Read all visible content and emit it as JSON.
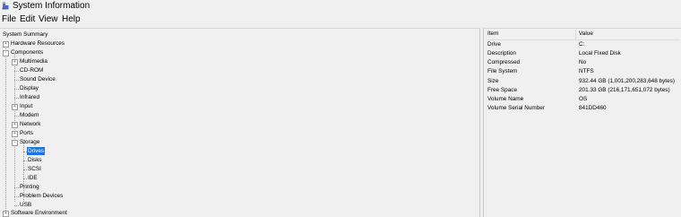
{
  "window": {
    "title": "System Information"
  },
  "menu": [
    "File",
    "Edit",
    "View",
    "Help"
  ],
  "tree": [
    {
      "label": "System Summary",
      "toggle": ""
    },
    {
      "label": "Hardware Resources",
      "toggle": "+"
    },
    {
      "label": "Components",
      "toggle": "-"
    },
    {
      "label": "Multimedia",
      "toggle": "+"
    },
    {
      "label": "CD-ROM",
      "toggle": ""
    },
    {
      "label": "Sound Device",
      "toggle": ""
    },
    {
      "label": "Display",
      "toggle": ""
    },
    {
      "label": "Infrared",
      "toggle": ""
    },
    {
      "label": "Input",
      "toggle": "+"
    },
    {
      "label": "Modem",
      "toggle": ""
    },
    {
      "label": "Network",
      "toggle": "+"
    },
    {
      "label": "Ports",
      "toggle": "+"
    },
    {
      "label": "Storage",
      "toggle": "-"
    },
    {
      "label": "Drives",
      "toggle": "",
      "selected": true
    },
    {
      "label": "Disks",
      "toggle": ""
    },
    {
      "label": "SCSI",
      "toggle": ""
    },
    {
      "label": "IDE",
      "toggle": ""
    },
    {
      "label": "Printing",
      "toggle": ""
    },
    {
      "label": "Problem Devices",
      "toggle": ""
    },
    {
      "label": "USB",
      "toggle": ""
    },
    {
      "label": "Software Environment",
      "toggle": "+"
    }
  ],
  "details": {
    "headers": {
      "item": "Item",
      "value": "Value"
    },
    "rows": [
      {
        "item": "Drive",
        "value": "C:"
      },
      {
        "item": "Description",
        "value": "Local Fixed Disk"
      },
      {
        "item": "Compressed",
        "value": "No"
      },
      {
        "item": "File System",
        "value": "NTFS"
      },
      {
        "item": "Size",
        "value": "932.44 GB (1,001,200,283,648 bytes)"
      },
      {
        "item": "Free Space",
        "value": "201.33 GB (216,171,651,072 bytes)"
      },
      {
        "item": "Volume Name",
        "value": "OS"
      },
      {
        "item": "Volume Serial Number",
        "value": "841DD460"
      }
    ]
  }
}
